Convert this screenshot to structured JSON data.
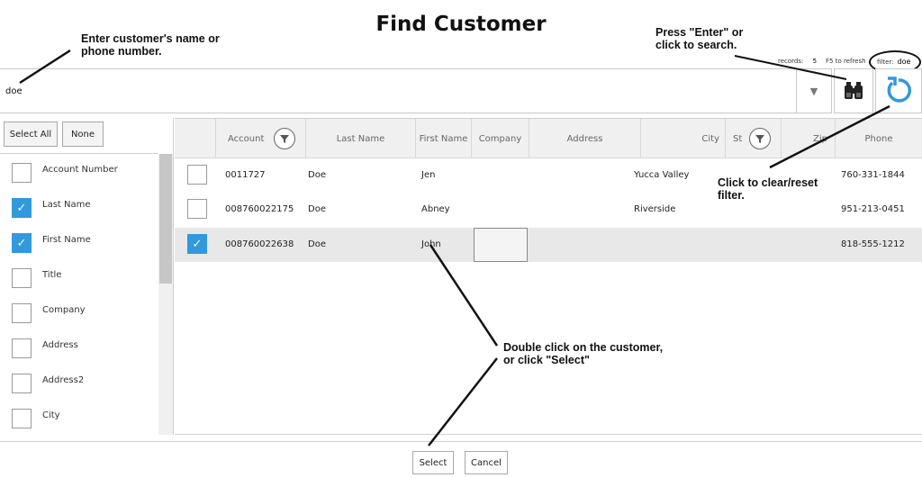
{
  "window": {
    "title": "Find Customer"
  },
  "annotations": {
    "enter_name_line1": "Enter customer's name or",
    "enter_name_line2": "phone number.",
    "press_enter_line1": "Press \"Enter\" or",
    "press_enter_line2": "click to search.",
    "clear_filter_line1": "Click to clear/reset",
    "clear_filter_line2": "filter.",
    "double_click_line1": "Double click on the customer,",
    "double_click_line2": "or click \"Select\""
  },
  "stats": {
    "records_label": "records:",
    "records_value": "5",
    "refresh_hint": "F5 to refresh",
    "filter_label": "filter:",
    "filter_value": "doe"
  },
  "search": {
    "value": "doe",
    "placeholder": ""
  },
  "icons": {
    "dropdown": "chevron-down-icon",
    "search": "binoculars-icon",
    "reset": "refresh-icon",
    "filter": "funnel-icon",
    "check": "checkmark-icon"
  },
  "colors": {
    "accent": "#3199dc",
    "selected_row": "#e8e8e8",
    "header_bg": "#f0f0f0"
  },
  "left_panel": {
    "select_all_label": "Select All",
    "none_label": "None",
    "fields": [
      {
        "label": "Account Number",
        "checked": false
      },
      {
        "label": "Last Name",
        "checked": true
      },
      {
        "label": "First Name",
        "checked": true
      },
      {
        "label": "Title",
        "checked": false
      },
      {
        "label": "Company",
        "checked": false
      },
      {
        "label": "Address",
        "checked": false
      },
      {
        "label": "Address2",
        "checked": false
      },
      {
        "label": "City",
        "checked": false
      }
    ]
  },
  "grid": {
    "columns": [
      "Account",
      "Last Name",
      "First Name",
      "Company",
      "Address",
      "City",
      "St",
      "Zip",
      "Phone"
    ],
    "rows": [
      {
        "selected": false,
        "account": "0011727",
        "last_name": "Doe",
        "first_name": "Jen",
        "company": "",
        "address": "",
        "city": "Yucca Valley",
        "state": "",
        "zip": "",
        "phone": "760-331-1844"
      },
      {
        "selected": false,
        "account": "008760022175",
        "last_name": "Doe",
        "first_name": "Abney",
        "company": "",
        "address": "",
        "city": "Riverside",
        "state": "",
        "zip": "",
        "phone": "951-213-0451"
      },
      {
        "selected": true,
        "account": "008760022638",
        "last_name": "Doe",
        "first_name": "John",
        "company": "",
        "address": "",
        "city": "",
        "state": "",
        "zip": "",
        "phone": "818-555-1212"
      }
    ]
  },
  "footer": {
    "select_label": "Select",
    "cancel_label": "Cancel"
  }
}
